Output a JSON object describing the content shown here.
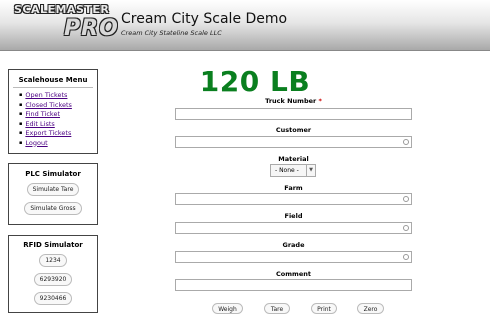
{
  "header": {
    "logo": {
      "line1": "SCALEMASTER",
      "line2": "PRO"
    },
    "title": "Cream City Scale Demo",
    "subtitle": "Cream City Stateline Scale LLC"
  },
  "menu": {
    "title": "Scalehouse Menu",
    "items": [
      {
        "label": "Open Tickets"
      },
      {
        "label": "Closed Tickets"
      },
      {
        "label": "Find Ticket"
      },
      {
        "label": "Edit Lists"
      },
      {
        "label": "Export Tickets"
      },
      {
        "label": "Logout"
      }
    ]
  },
  "plc": {
    "title": "PLC Simulator",
    "buttons": [
      "Simulate Tare",
      "Simulate Gross"
    ]
  },
  "rfid": {
    "title": "RFID Simulator",
    "buttons": [
      "1234",
      "6293920",
      "9230466"
    ]
  },
  "weight": "120 LB",
  "form": {
    "truck_number": {
      "label": "Truck Number",
      "required_mark": "*",
      "value": ""
    },
    "customer": {
      "label": "Customer",
      "value": ""
    },
    "material": {
      "label": "Material",
      "value": "- None -"
    },
    "farm": {
      "label": "Farm",
      "value": ""
    },
    "field": {
      "label": "Field",
      "value": ""
    },
    "grade": {
      "label": "Grade",
      "value": ""
    },
    "comment": {
      "label": "Comment",
      "value": ""
    }
  },
  "actions": [
    "Weigh",
    "Tare",
    "Print",
    "Zero"
  ],
  "colors": {
    "weight": "#0a7f1f",
    "link": "#4b0082",
    "required": "#cc0000"
  }
}
